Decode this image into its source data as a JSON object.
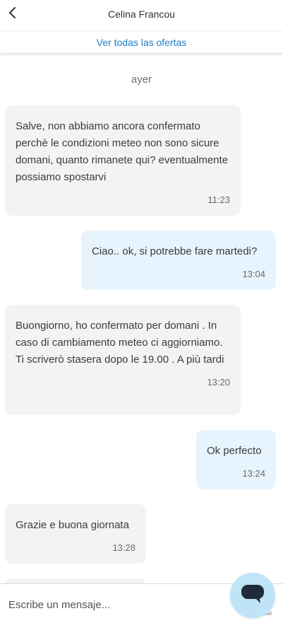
{
  "header": {
    "title": "Celina Francou"
  },
  "offers": {
    "link_label": "Ver todas las ofertas"
  },
  "day_separator": "ayer",
  "messages": [
    {
      "direction": "incoming",
      "text": "Salve, non abbiamo ancora confermato perchè le condizioni meteo non sono sicure domani, quanto rimanete qui? eventualmente possiamo spostarvi",
      "time": "11:23"
    },
    {
      "direction": "outgoing",
      "text": "Ciao.. ok, si potrebbe fare martedi?",
      "time": "13:04"
    },
    {
      "direction": "incoming",
      "text": "Buongiorno, ho confermato per domani . In caso di cambiamento meteo ci aggiorniamo. Ti scriverò stasera dopo le 19.00 . A più tardi",
      "time": "13:20"
    },
    {
      "direction": "outgoing",
      "text": "Ok perfecto",
      "time": "13:24"
    },
    {
      "direction": "incoming",
      "text": "Grazie e buona giornata",
      "time": "13:28"
    }
  ],
  "composer": {
    "placeholder": "Escribe un mensaje..."
  },
  "icons": {
    "back": "chevron-left-icon",
    "send": "send-arrow-icon",
    "chat": "chat-bubble-icon"
  },
  "colors": {
    "accent_link": "#1d7dc6",
    "incoming_bubble": "#f3f3f3",
    "outgoing_bubble": "#e8f4fd",
    "fab_background": "#bfe4f8",
    "fab_icon": "#1f2a3a"
  }
}
